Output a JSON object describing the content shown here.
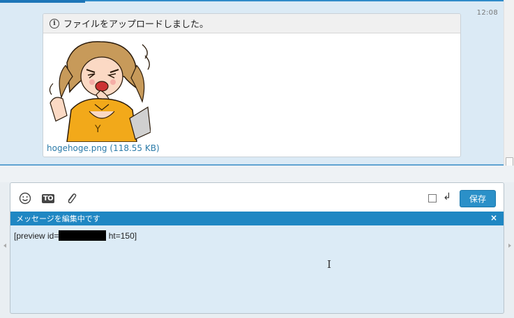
{
  "timeline": {
    "timestamp": "12:08",
    "message": {
      "header_text": "ファイルをアップロードしました。",
      "file_name": "hogehoge.png",
      "file_size": "(118.55 KB)"
    }
  },
  "composer": {
    "toolbar": {
      "emoticon_icon": "smiley-icon",
      "to_label": "TO",
      "attach_icon": "paperclip-icon",
      "enter_arrow": "↲",
      "save_label": "保存"
    },
    "edit_banner": {
      "text": "メッセージを編集中です",
      "close": "×"
    },
    "message_text_before": "[preview id=",
    "message_text_after": " ht=150]"
  }
}
